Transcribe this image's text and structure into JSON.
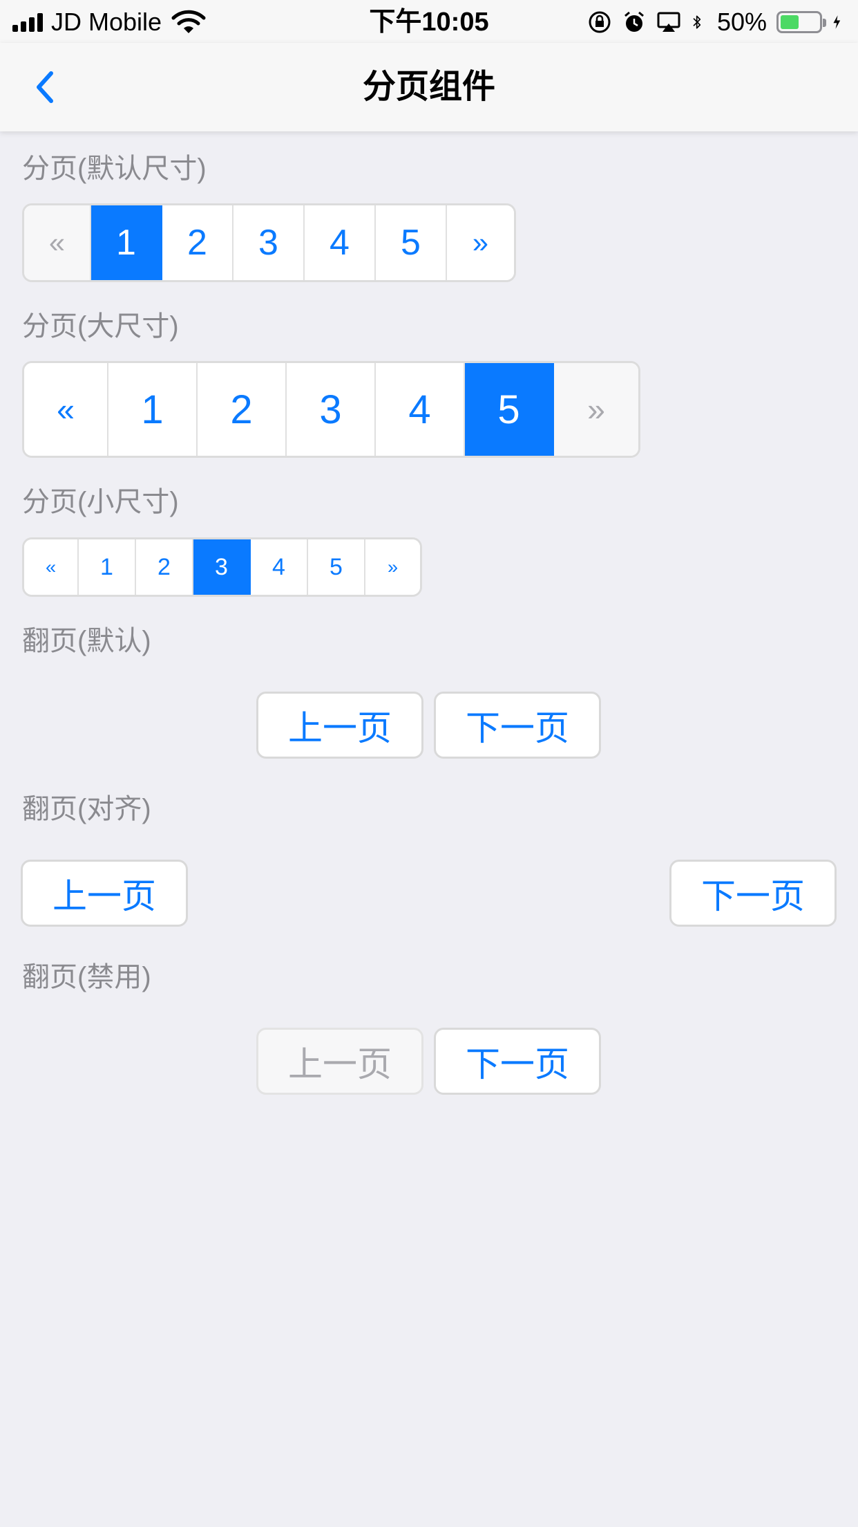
{
  "status_bar": {
    "carrier": "JD Mobile",
    "time": "下午10:05",
    "battery_percent": "50%",
    "battery_level": 0.5,
    "icons": [
      "signal-icon",
      "wifi-icon",
      "rotation-lock-icon",
      "alarm-icon",
      "airplay-icon",
      "bluetooth-icon",
      "battery-icon",
      "charging-icon"
    ]
  },
  "nav": {
    "title": "分页组件",
    "back_icon": "chevron-left-icon"
  },
  "sections": {
    "default_size": {
      "title": "分页(默认尺寸)",
      "prev": "«",
      "next": "»",
      "pages": [
        "1",
        "2",
        "3",
        "4",
        "5"
      ],
      "active_page": "1",
      "prev_disabled": true,
      "next_disabled": false
    },
    "large_size": {
      "title": "分页(大尺寸)",
      "prev": "«",
      "next": "»",
      "pages": [
        "1",
        "2",
        "3",
        "4",
        "5"
      ],
      "active_page": "5",
      "prev_disabled": false,
      "next_disabled": true
    },
    "small_size": {
      "title": "分页(小尺寸)",
      "prev": "«",
      "next": "»",
      "pages": [
        "1",
        "2",
        "3",
        "4",
        "5"
      ],
      "active_page": "3",
      "prev_disabled": false,
      "next_disabled": false
    },
    "flip_default": {
      "title": "翻页(默认)",
      "prev_label": "上一页",
      "next_label": "下一页"
    },
    "flip_justify": {
      "title": "翻页(对齐)",
      "prev_label": "上一页",
      "next_label": "下一页"
    },
    "flip_disabled": {
      "title": "翻页(禁用)",
      "prev_label": "上一页",
      "next_label": "下一页",
      "prev_disabled": true
    }
  },
  "colors": {
    "accent": "#0a7aff",
    "background": "#efeff4",
    "section_title": "#8a8a8f",
    "disabled_text": "#a9a9ae"
  }
}
